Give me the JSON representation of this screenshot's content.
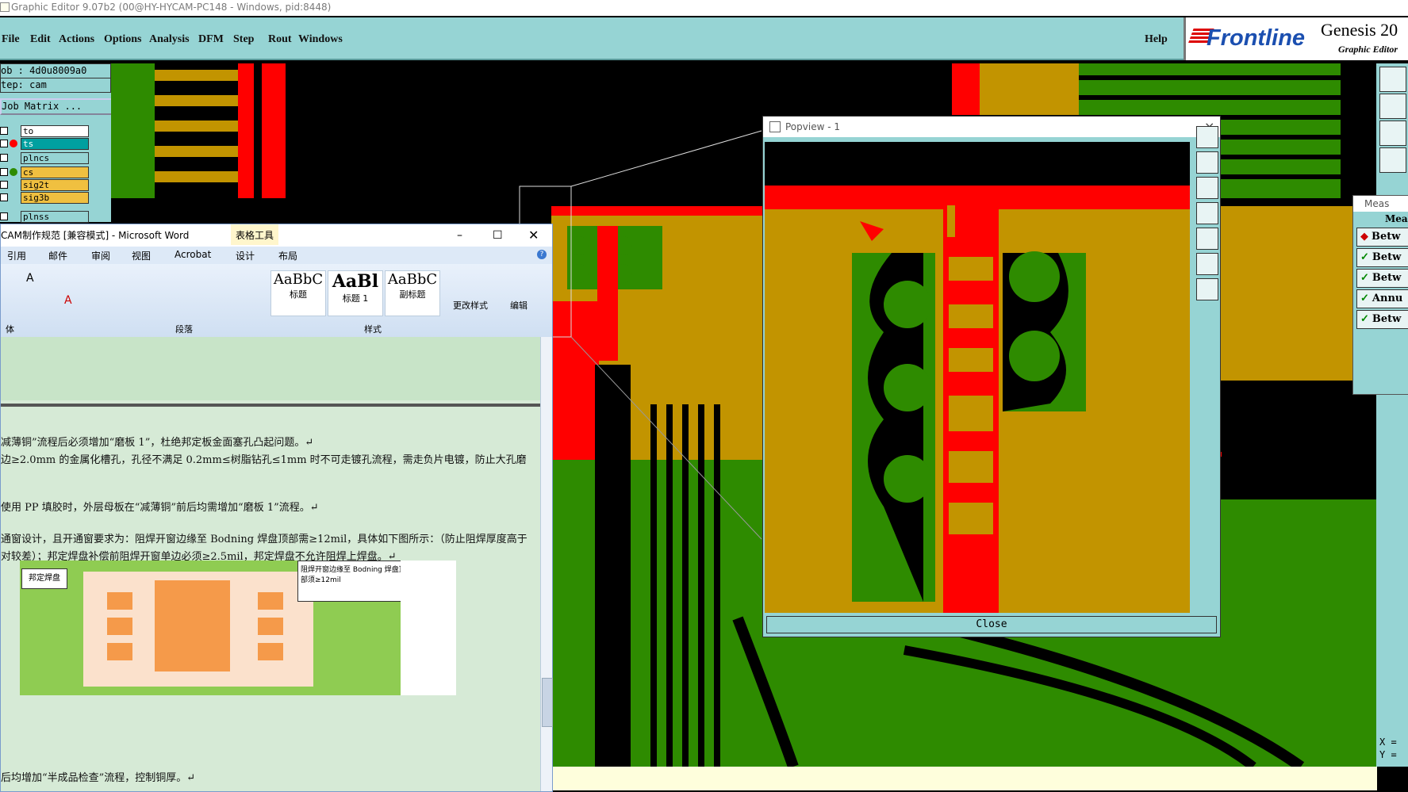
{
  "window": {
    "title": "Graphic Editor 9.07b2 (00@HY-HYCAM-PC148 - Windows, pid:8448)"
  },
  "menu": {
    "items": [
      "File",
      "Edit",
      "Actions",
      "Options",
      "Analysis",
      "DFM",
      "Step",
      "Rout",
      "Windows"
    ],
    "help": "Help"
  },
  "brand": {
    "logo": "Frontline",
    "product": "Genesis 20",
    "subtitle": "Graphic Editor"
  },
  "job": {
    "job_line": "ob : 4d0u8009a0",
    "step_line": "tep: cam",
    "matrix_button": "Job Matrix ..."
  },
  "layers": [
    {
      "name": "to",
      "dot": ""
    },
    {
      "name": "ts",
      "dot": "#ff0000"
    },
    {
      "name": "plncs",
      "dot": ""
    },
    {
      "name": "cs",
      "dot": "#2e8b00"
    },
    {
      "name": "sig2t",
      "dot": ""
    },
    {
      "name": "sig3b",
      "dot": ""
    },
    {
      "name": "plnss",
      "dot": ""
    }
  ],
  "word": {
    "title": "CAM制作规范 [兼容模式] - Microsoft Word",
    "context_tab": "表格工具",
    "tabs": [
      "引用",
      "邮件",
      "审阅",
      "视图",
      "Acrobat",
      "设计",
      "布局"
    ],
    "styles": [
      {
        "preview": "AaBbC",
        "label": "标题"
      },
      {
        "preview": "AaBl",
        "label": "标题 1"
      },
      {
        "preview": "AaBbC",
        "label": "副标题"
      }
    ],
    "change_styles": "更改样式",
    "edit": "编辑",
    "group_paragraph": "段落",
    "group_styles": "样式",
    "group_font": "体",
    "doc_lines": [
      "减薄铜”流程后必须增加“磨板 1”，杜绝邦定板金面塞孔凸起问题。↵",
      "边≥2.0mm 的金属化槽孔，孔径不满足 0.2mm≤树脂钻孔≤1mm 时不可走镀孔流程，需走负片电镀，防止大孔磨",
      "使用 PP 填胶时，外层母板在“减薄铜”前后均需增加“磨板 1”流程。↵",
      "通窗设计，且开通窗要求为：阻焊开窗边缘至 Bodning 焊盘顶部需≥12mil，具体如下图所示：（防止阻焊厚度高于",
      "对较差）；邦定焊盘补偿前阻焊开窗单边必须≥2.5mil，邦定焊盘不允许阻焊上焊盘。↵",
      "后均增加“半成品检查”流程，控制铜厚。↵"
    ],
    "figure": {
      "label_left": "邦定焊盘",
      "label_right": "阻焊开窗边缘至 Bodning 焊盘顶部须≥12mil"
    }
  },
  "popview": {
    "title": "Popview - 1",
    "close_label": "Close"
  },
  "measure": {
    "title": "Meas",
    "header": "Mea",
    "rows": [
      "Betw",
      "Betw",
      "Betw",
      "Annu",
      "Betw"
    ]
  },
  "coords": {
    "x": "X =",
    "y": "Y ="
  },
  "colors": {
    "teal": "#96d4d4",
    "red": "#ff0000",
    "green": "#2e8b00",
    "gold": "#c29400"
  }
}
